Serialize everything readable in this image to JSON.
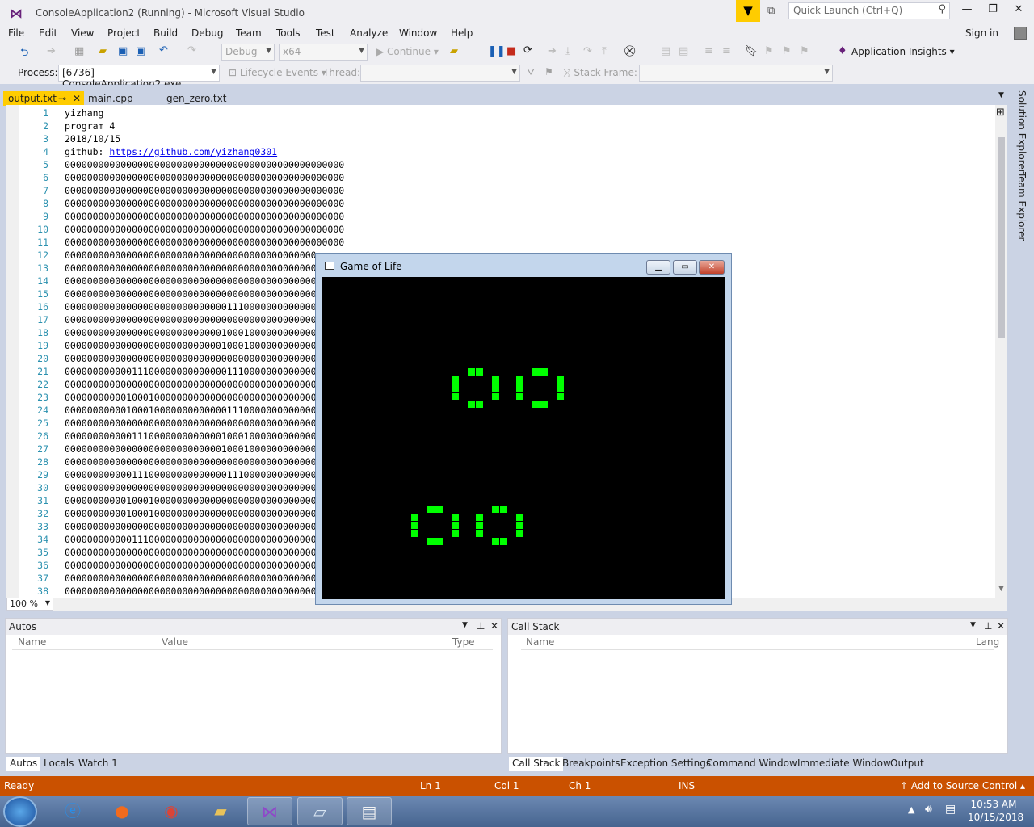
{
  "window": {
    "title": "ConsoleApplication2 (Running) - Microsoft Visual Studio",
    "sign_in": "Sign in"
  },
  "quick_launch": {
    "placeholder": "Quick Launch (Ctrl+Q)"
  },
  "menu": [
    "File",
    "Edit",
    "View",
    "Project",
    "Build",
    "Debug",
    "Team",
    "Tools",
    "Test",
    "Analyze",
    "Window",
    "Help"
  ],
  "toolbar": {
    "config": "Debug",
    "platform": "x64",
    "continue": "Continue",
    "app_insights": "Application Insights",
    "process_label": "Process:",
    "process_value": "[6736] ConsoleApplication2.exe",
    "lifecycle": "Lifecycle Events",
    "thread_label": "Thread:",
    "stack_frame_label": "Stack Frame:"
  },
  "tabs": [
    {
      "label": "output.txt",
      "active": true
    },
    {
      "label": "main.cpp"
    },
    {
      "label": "gen_zero.txt"
    }
  ],
  "editor": {
    "line_numbers": [
      "1",
      "2",
      "3",
      "4",
      "5",
      "6",
      "7",
      "8",
      "9",
      "10",
      "11",
      "12",
      "13",
      "14",
      "15",
      "16",
      "17",
      "18",
      "19",
      "20",
      "21",
      "22",
      "23",
      "24",
      "25",
      "26",
      "27",
      "28",
      "29",
      "30",
      "31",
      "32",
      "33",
      "34",
      "35",
      "36",
      "37",
      "38"
    ],
    "lines": [
      "yizhang",
      "program 4",
      "2018/10/15",
      "github: ",
      "00000000000000000000000000000000000000000000000000",
      "00000000000000000000000000000000000000000000000000",
      "00000000000000000000000000000000000000000000000000",
      "00000000000000000000000000000000000000000000000000",
      "00000000000000000000000000000000000000000000000000",
      "00000000000000000000000000000000000000000000000000",
      "00000000000000000000000000000000000000000000000000",
      "000000000000000000000000000000000000000000000",
      "000000000000000000000000000000000000000000000",
      "000000000000000000000000000000000000000000000",
      "000000000000000000000000000000000000000000000",
      "000000000000000000000000000001110000000000000",
      "000000000000000000000000000000000000000000000",
      "000000000000000000000000000010001000000000000",
      "000000000000000000000000000010001000000000000",
      "000000000000000000000000000000000000000000000",
      "000000000000111000000000000001110000000000000",
      "000000000000000000000000000000000000000000000",
      "000000000001000100000000000000000000000000000",
      "000000000001000100000000000001110000000000000",
      "000000000000000000000000000000000000000000000",
      "000000000000111000000000000010001000000000000",
      "000000000000000000000000000010001000000000000",
      "000000000000000000000000000000000000000000000",
      "000000000000111000000000000001110000000000000",
      "000000000000000000000000000000000000000000000",
      "000000000001000100000000000000000000000000000",
      "000000000001000100000000000000000000000000000",
      "000000000000000000000000000000000000000000000",
      "000000000000111000000000000000000000000000000",
      "000000000000000000000000000000000000000000000",
      "000000000000000000000000000000000000000000000",
      "000000000000000000000000000000000000000000000",
      "000000000000000000000000000000000000000000000"
    ],
    "link": "https://github.com/yizhang0301",
    "zoom": "100 %"
  },
  "right_tabs": [
    "Solution Explorer",
    "Team Explorer"
  ],
  "game_window": {
    "title": "Game of Life"
  },
  "autos_panel": {
    "title": "Autos",
    "columns": [
      "Name",
      "Value",
      "Type"
    ],
    "tabs": [
      "Autos",
      "Locals",
      "Watch 1"
    ]
  },
  "callstack_panel": {
    "title": "Call Stack",
    "columns": [
      "Name",
      "Lang"
    ],
    "tabs": [
      "Call Stack",
      "Breakpoints",
      "Exception Settings",
      "Command Window",
      "Immediate Window",
      "Output"
    ]
  },
  "status": {
    "ready": "Ready",
    "ln": "Ln 1",
    "col": "Col 1",
    "ch": "Ch 1",
    "ins": "INS",
    "source_control": "Add to Source Control"
  },
  "clock": {
    "time": "10:53 AM",
    "date": "10/15/2018"
  },
  "colors": {
    "accent": "#ffcc00",
    "status_bar": "#ca5100",
    "cell": "#00ff00"
  }
}
